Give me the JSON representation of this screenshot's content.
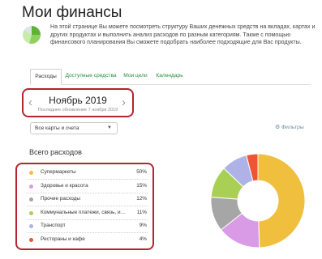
{
  "page": {
    "title": "Мои финансы",
    "intro": "На этой странице Вы можете посмотреть структуру Ваших денежных средств на вкладах, картах и других продуктах и выполнить анализ расходов по разным категориям. Также с помощью финансового планирования Вы сможете подобрать наиболее подходящие для Вас продукты."
  },
  "tabs": [
    {
      "label": "Расходы",
      "active": true
    },
    {
      "label": "Доступные средства",
      "active": false
    },
    {
      "label": "Мои цели",
      "active": false
    },
    {
      "label": "Календарь",
      "active": false
    }
  ],
  "period": {
    "month": "Ноябрь 2019",
    "updated": "Последнее обновление 7 ноября 2019",
    "prev": "‹",
    "next": "›"
  },
  "filters": {
    "account_select": "Все карты и счета",
    "filters_label": "Фильтры"
  },
  "expenses": {
    "heading": "Всего расходов",
    "categories": [
      {
        "name": "Супермаркеты",
        "percent": "50%",
        "value": 50,
        "color": "#f0bf3e"
      },
      {
        "name": "Здоровье и красота",
        "percent": "15%",
        "value": 15,
        "color": "#d99ae6"
      },
      {
        "name": "Прочие расходы",
        "percent": "12%",
        "value": 12,
        "color": "#a6a6a6"
      },
      {
        "name": "Коммунальные платежи, связь, и…",
        "percent": "11%",
        "value": 11,
        "color": "#a9d055"
      },
      {
        "name": "Транспорт",
        "percent": "9%",
        "value": 9,
        "color": "#aeb2e6"
      },
      {
        "name": "Рестораны и кафе",
        "percent": "4%",
        "value": 4,
        "color": "#ee5535"
      }
    ]
  },
  "colors": {
    "accent_green": "#23903a",
    "highlight_red": "#b5232e"
  }
}
